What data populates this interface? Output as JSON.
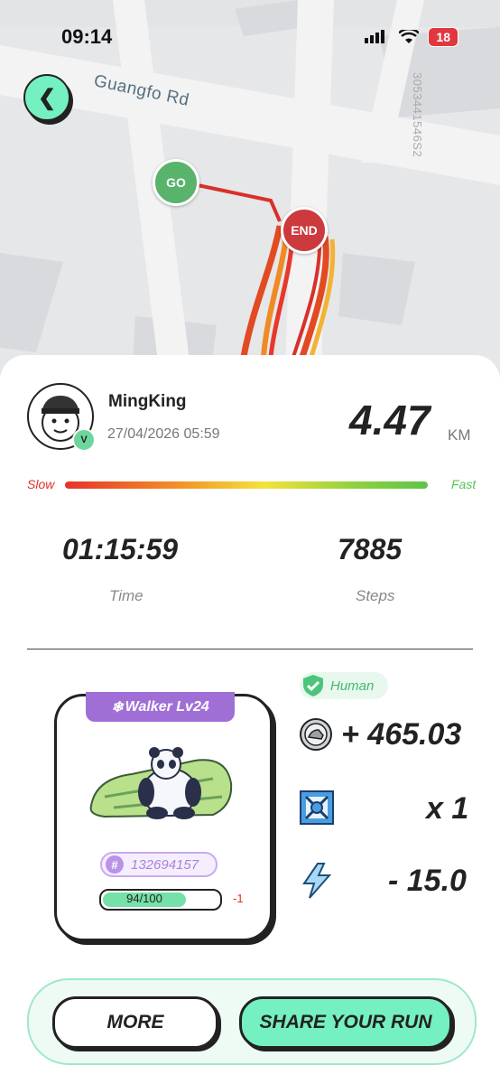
{
  "status_bar": {
    "time": "09:14",
    "battery": "18"
  },
  "map": {
    "road_label": "Guangfo Rd",
    "map_id": "3053441546S2",
    "go_label": "GO",
    "end_label": "END"
  },
  "run": {
    "username": "MingKing",
    "datetime": "27/04/2026 05:59",
    "distance": "4.47",
    "distance_unit": "KM",
    "speed_slow": "Slow",
    "speed_fast": "Fast",
    "time_value": "01:15:59",
    "time_label": "Time",
    "steps_value": "7885",
    "steps_label": "Steps"
  },
  "sneaker": {
    "level_label": "Walker Lv24",
    "id": "132694157",
    "durability_text": "94/100",
    "durability": 0.94,
    "durability_delta": "-1"
  },
  "rewards": {
    "human_badge": "Human",
    "gst_earned": "+ 465.03",
    "mystery_box": "x 1",
    "energy": "- 15.0"
  },
  "actions": {
    "more_label": "MORE",
    "share_label": "SHARE YOUR RUN"
  },
  "colors": {
    "accent": "#75f0c0",
    "level_purple": "#a06fd6",
    "go_green": "#59b36a",
    "end_red": "#cc3a3e"
  }
}
